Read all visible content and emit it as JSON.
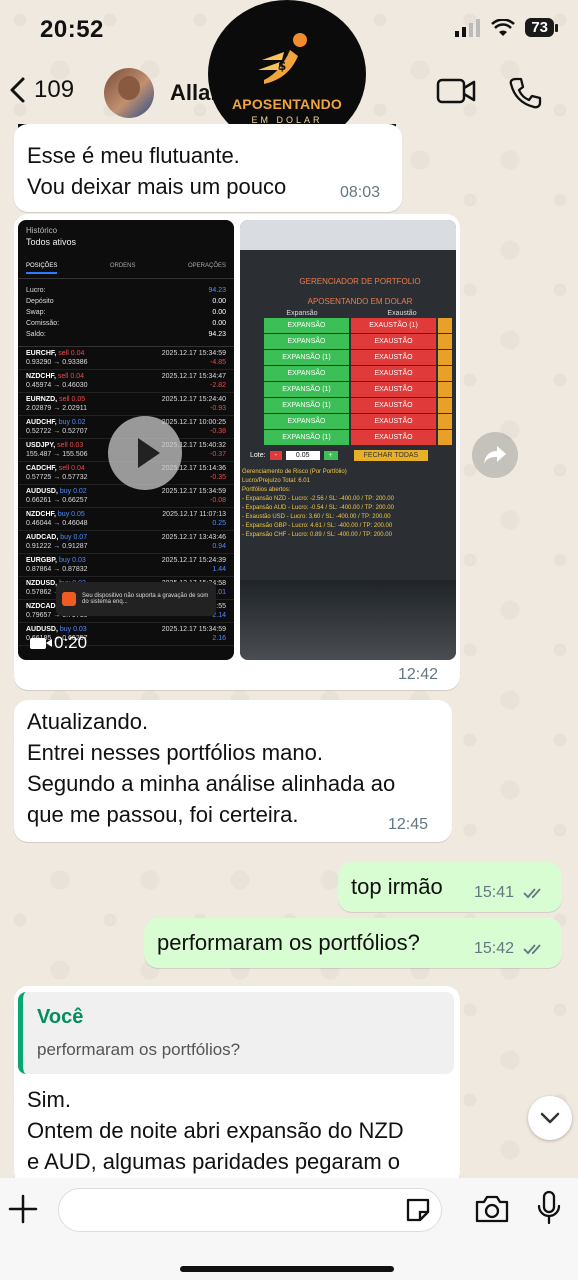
{
  "status_bar": {
    "time": "20:52",
    "battery": "73"
  },
  "header": {
    "back_count": "109",
    "contact_name": "Allan"
  },
  "logo": {
    "line1": "APOSENTANDO",
    "line2": "EM DOLAR"
  },
  "messages": {
    "m1": {
      "text": "Esse é meu flutuante.\nVou deixar mais um pouco",
      "time": "08:03"
    },
    "media": {
      "time": "12:42",
      "video_duration": "0:20",
      "left": {
        "header": "Histórico",
        "subheader": "Todos ativos",
        "tabs": [
          "POSIÇÕES",
          "ORDENS",
          "OPERAÇÕES"
        ],
        "summary": [
          {
            "label": "Lucro:",
            "value": "94.23"
          },
          {
            "label": "Depósito",
            "value": "0.00"
          },
          {
            "label": "Swap:",
            "value": "0.00"
          },
          {
            "label": "Comissão:",
            "value": "0.00"
          },
          {
            "label": "Saldo:",
            "value": "94.23"
          }
        ],
        "trades": [
          {
            "symbol": "EURCHF,",
            "side": "sell 0.04",
            "prices": "0.93290 → 0.93386",
            "date": "2025.12.17 15:34:59",
            "pnl": "-4.85"
          },
          {
            "symbol": "NZDCHF,",
            "side": "sell 0.04",
            "prices": "0.45974 → 0.46030",
            "date": "2025.12.17 15:34:47",
            "pnl": "-2.82"
          },
          {
            "symbol": "EURNZD,",
            "side": "sell 0.05",
            "prices": "2.02879 → 2.02911",
            "date": "2025.12.17 15:24:40",
            "pnl": "-0.93"
          },
          {
            "symbol": "AUDCHF,",
            "side": "buy 0.02",
            "prices": "0.52722 → 0.52707",
            "date": "2025.12.17 10:00:25",
            "pnl": "-0.38"
          },
          {
            "symbol": "USDJPY,",
            "side": "sell 0.03",
            "prices": "155.487 → 155.506",
            "date": "2025.12.17 15:40:32",
            "pnl": "-0.37"
          },
          {
            "symbol": "CADCHF,",
            "side": "sell 0.04",
            "prices": "0.57725 → 0.57732",
            "date": "2025.12.17 15:14:36",
            "pnl": "-0.35"
          },
          {
            "symbol": "AUDUSD,",
            "side": "buy 0.02",
            "prices": "0.66261 → 0.66257",
            "date": "2025.12.17 15:34:59",
            "pnl": "-0.08"
          },
          {
            "symbol": "NZDCHF,",
            "side": "buy 0.05",
            "prices": "0.46044 → 0.46048",
            "date": "2025.12.17 11:07:13",
            "pnl": "0.25"
          },
          {
            "symbol": "AUDCAD,",
            "side": "buy 0.07",
            "prices": "0.91222 → 0.91287",
            "date": "2025.12.17 13:43:46",
            "pnl": "0.94"
          },
          {
            "symbol": "EURGBP,",
            "side": "buy 0.03",
            "prices": "0.87864 → 0.87832",
            "date": "2025.12.17 15:24:39",
            "pnl": "1.44"
          },
          {
            "symbol": "NZDUSD,",
            "side": "buy 0.03",
            "prices": "0.57862 → 0.57902",
            "date": "2025.12.17 15:34:58",
            "pnl": "2.01"
          },
          {
            "symbol": "NZDCAD,",
            "side": "buy 0.04",
            "prices": "0.79657 → 0.79710",
            "date": "2025.12.17 15:34:55",
            "pnl": "2.14"
          },
          {
            "symbol": "AUDUSD,",
            "side": "buy 0.03",
            "prices": "0.66185 → 0.66257",
            "date": "2025.12.17 15:34:59",
            "pnl": "2.16"
          }
        ],
        "toast": "Seu dispositivo não suporta a gravação de som do sistema enq..."
      },
      "right": {
        "title1": "GERENCIADOR DE PORTFOLIO",
        "title2": "APOSENTANDO EM DOLAR",
        "col_expansao": "Expansão",
        "col_exaustao": "Exaustão",
        "rows": [
          {
            "exp": "EXPANSÃO",
            "exa": "EXAUSTÃO (1)"
          },
          {
            "exp": "EXPANSÃO",
            "exa": "EXAUSTÃO"
          },
          {
            "exp": "EXPANSÃO (1)",
            "exa": "EXAUSTÃO"
          },
          {
            "exp": "EXPANSÃO",
            "exa": "EXAUSTÃO"
          },
          {
            "exp": "EXPANSÃO (1)",
            "exa": "EXAUSTÃO"
          },
          {
            "exp": "EXPANSÃO (1)",
            "exa": "EXAUSTÃO"
          },
          {
            "exp": "EXPANSÃO",
            "exa": "EXAUSTÃO"
          },
          {
            "exp": "EXPANSÃO (1)",
            "exa": "EXAUSTÃO"
          }
        ],
        "lote_label": "Lote:",
        "lote_value": "0.05",
        "fechar_label": "FECHAR TODAS",
        "risk_lines": [
          "Gerenciamento de Risco (Por Portfólio)",
          "Lucro/Prejuízo Total: 6.01",
          "Portfólios abertos:",
          "- Expansão NZD - Lucro: -2.56 / SL: -400.00 / TP: 200.00",
          "- Expansão AUD - Lucro: -0.54 / SL: -400.00 / TP: 200.00",
          "- Exaustão USD - Lucro: 3.60 / SL: -400.00 / TP: 200.00",
          "- Expansão GBP - Lucro: 4.61 / SL: -400.00 / TP: 200.00",
          "- Expansão CHF - Lucro: 0.89 / SL: -400.00 / TP: 200.00"
        ]
      }
    },
    "m2": {
      "text": "Atualizando.\nEntrei nesses portfólios mano.\nSegundo a minha análise alinhada ao\nque me passou, foi certeira.",
      "time": "12:45"
    },
    "m3": {
      "text": "top irmão",
      "time": "15:41"
    },
    "m4": {
      "text": "performaram os portfólios?",
      "time": "15:42"
    },
    "m5": {
      "quote_author": "Você",
      "quote_text": "performaram os portfólios?",
      "text": "Sim.\nOntem de noite abri expansão do NZD\ne AUD, algumas paridades pegaram o"
    }
  },
  "colors": {
    "accent": "#06a870",
    "outgoing": "#d9fdd3",
    "read_ticks": "#53bdeb"
  }
}
